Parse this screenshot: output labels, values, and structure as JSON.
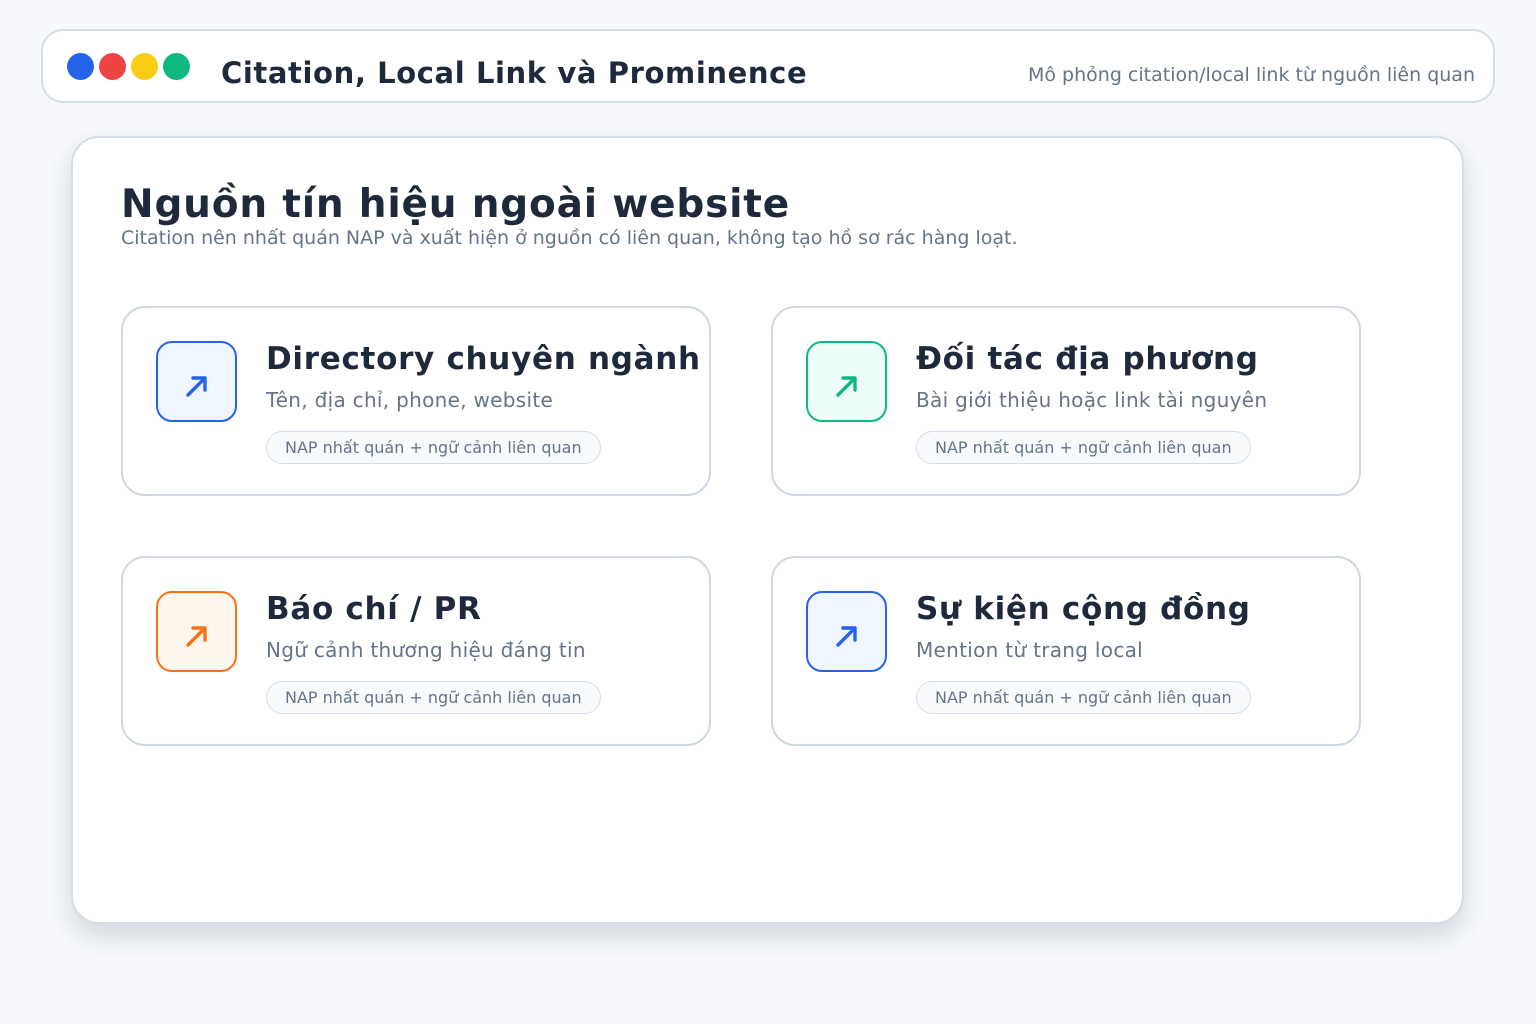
{
  "window": {
    "title": "Citation, Local Link và Prominence",
    "subtitle": "Mô phỏng citation/local link từ nguồn liên quan",
    "controls": [
      {
        "name": "blue-dot",
        "color": "#2563eb"
      },
      {
        "name": "red-dot",
        "color": "#ef4444"
      },
      {
        "name": "yellow-dot",
        "color": "#facc15"
      },
      {
        "name": "green-dot",
        "color": "#10b981"
      }
    ]
  },
  "main": {
    "heading": "Nguồn tín hiệu ngoài website",
    "subheading": "Citation nên nhất quán NAP và xuất hiện ở nguồn có liên quan, không tạo hồ sơ rác hàng loạt.",
    "cards": [
      {
        "title": "Directory chuyên ngành",
        "description": "Tên, địa chỉ, phone, website",
        "tag": "NAP nhất quán + ngữ cảnh liên quan",
        "icon": "arrow-up-right-icon",
        "accent": "#2563eb",
        "accent_bg": "#eff6ff"
      },
      {
        "title": "Đối tác địa phương",
        "description": "Bài giới thiệu hoặc link tài nguyên",
        "tag": "NAP nhất quán + ngữ cảnh liên quan",
        "icon": "arrow-up-right-icon",
        "accent": "#10b981",
        "accent_bg": "#ecfdf5"
      },
      {
        "title": "Báo chí / PR",
        "description": "Ngữ cảnh thương hiệu đáng tin",
        "tag": "NAP nhất quán + ngữ cảnh liên quan",
        "icon": "arrow-up-right-icon",
        "accent": "#f97316",
        "accent_bg": "#fff7ed"
      },
      {
        "title": "Sự kiện cộng đồng",
        "description": "Mention từ trang local",
        "tag": "NAP nhất quán + ngữ cảnh liên quan",
        "icon": "arrow-up-right-icon",
        "accent": "#2563eb",
        "accent_bg": "#eff6ff"
      }
    ]
  }
}
